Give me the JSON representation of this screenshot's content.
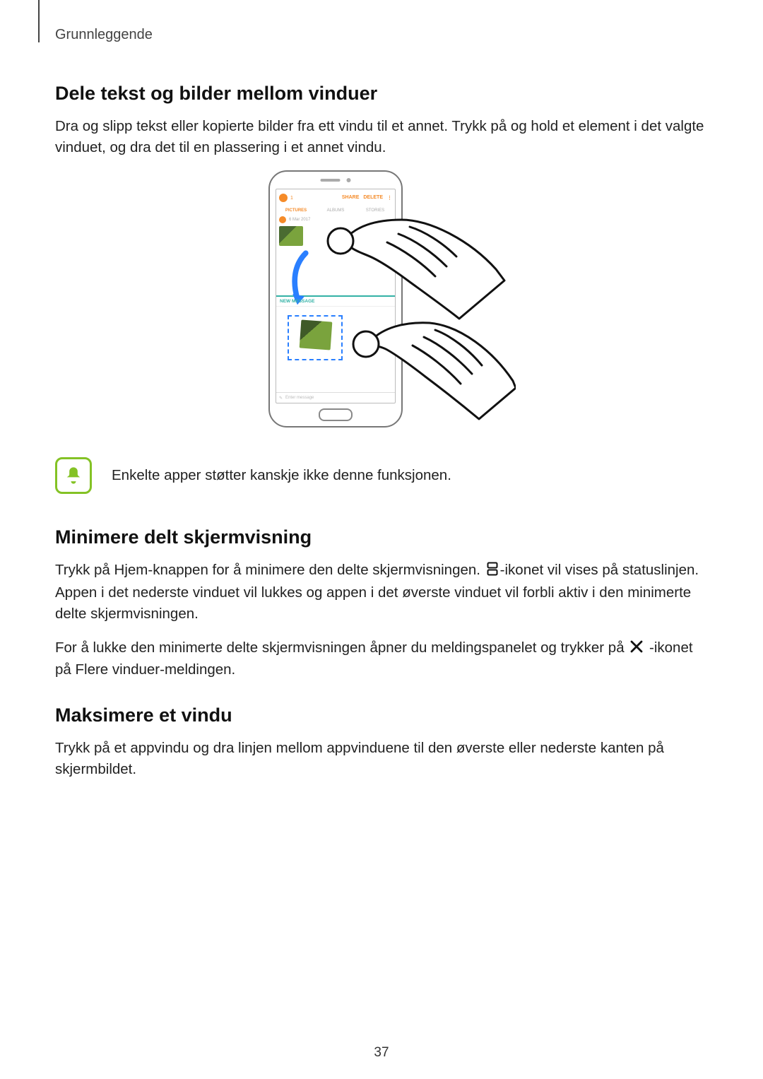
{
  "chapter": "Grunnleggende",
  "section1": {
    "heading": "Dele tekst og bilder mellom vinduer",
    "para": "Dra og slipp tekst eller kopierte bilder fra ett vindu til et annet. Trykk på og hold et element i det valgte vinduet, og dra det til en plassering i et annet vindu."
  },
  "figure": {
    "topbar_count": "1",
    "topbar_share": "SHARE",
    "topbar_delete": "DELETE",
    "tab_pictures": "PICTURES",
    "tab_albums": "ALBUMS",
    "tab_stories": "STORIES",
    "msg_date": "6 Mar 2017",
    "new_message": "NEW MESSAGE",
    "input_placeholder": "Enter message"
  },
  "note": {
    "text": "Enkelte apper støtter kanskje ikke denne funksjonen."
  },
  "section2": {
    "heading": "Minimere delt skjermvisning",
    "para1_a": "Trykk på Hjem-knappen for å minimere den delte skjermvisningen. ",
    "para1_b": "-ikonet vil vises på statuslinjen. Appen i det nederste vinduet vil lukkes og appen i det øverste vinduet vil forbli aktiv i den minimerte delte skjermvisningen.",
    "para2_a": "For å lukke den minimerte delte skjermvisningen åpner du meldingspanelet og trykker på ",
    "para2_b": " -ikonet på Flere vinduer-meldingen."
  },
  "section3": {
    "heading": "Maksimere et vindu",
    "para": "Trykk på et appvindu og dra linjen mellom appvinduene til den øverste eller nederste kanten på skjermbildet."
  },
  "page_number": "37"
}
